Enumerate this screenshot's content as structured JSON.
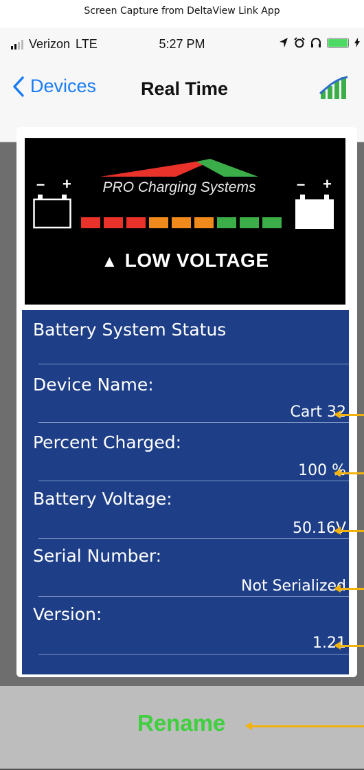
{
  "caption": "Screen Capture from DeltaView Link App",
  "statusbar": {
    "carrier": "Verizon",
    "network": "LTE",
    "time": "5:27 PM"
  },
  "navbar": {
    "back_label": "Devices",
    "title": "Real Time"
  },
  "banner": {
    "brand": "PRO Charging Systems",
    "warning": "LOW VOLTAGE",
    "minus": "–",
    "plus": "+",
    "led_colors": [
      "#e8322a",
      "#e8322a",
      "#e8322a",
      "#f08a1c",
      "#f08a1c",
      "#f08a1c",
      "#3cae49",
      "#3cae49",
      "#3cae49"
    ]
  },
  "status": {
    "title": "Battery System Status",
    "rows": [
      {
        "label": "Device Name:",
        "value": "Cart 32"
      },
      {
        "label": "Percent Charged:",
        "value": "100 %"
      },
      {
        "label": "Battery Voltage:",
        "value": "50.16V"
      },
      {
        "label": "Serial Number:",
        "value": "Not Serialized"
      },
      {
        "label": "Version:",
        "value": "1.21"
      }
    ]
  },
  "rename_label": "Rename",
  "colors": {
    "accent_blue": "#1a7cf5",
    "panel": "#1e3f87",
    "rename": "#3fcf3f",
    "callout": "#f2b30e"
  }
}
